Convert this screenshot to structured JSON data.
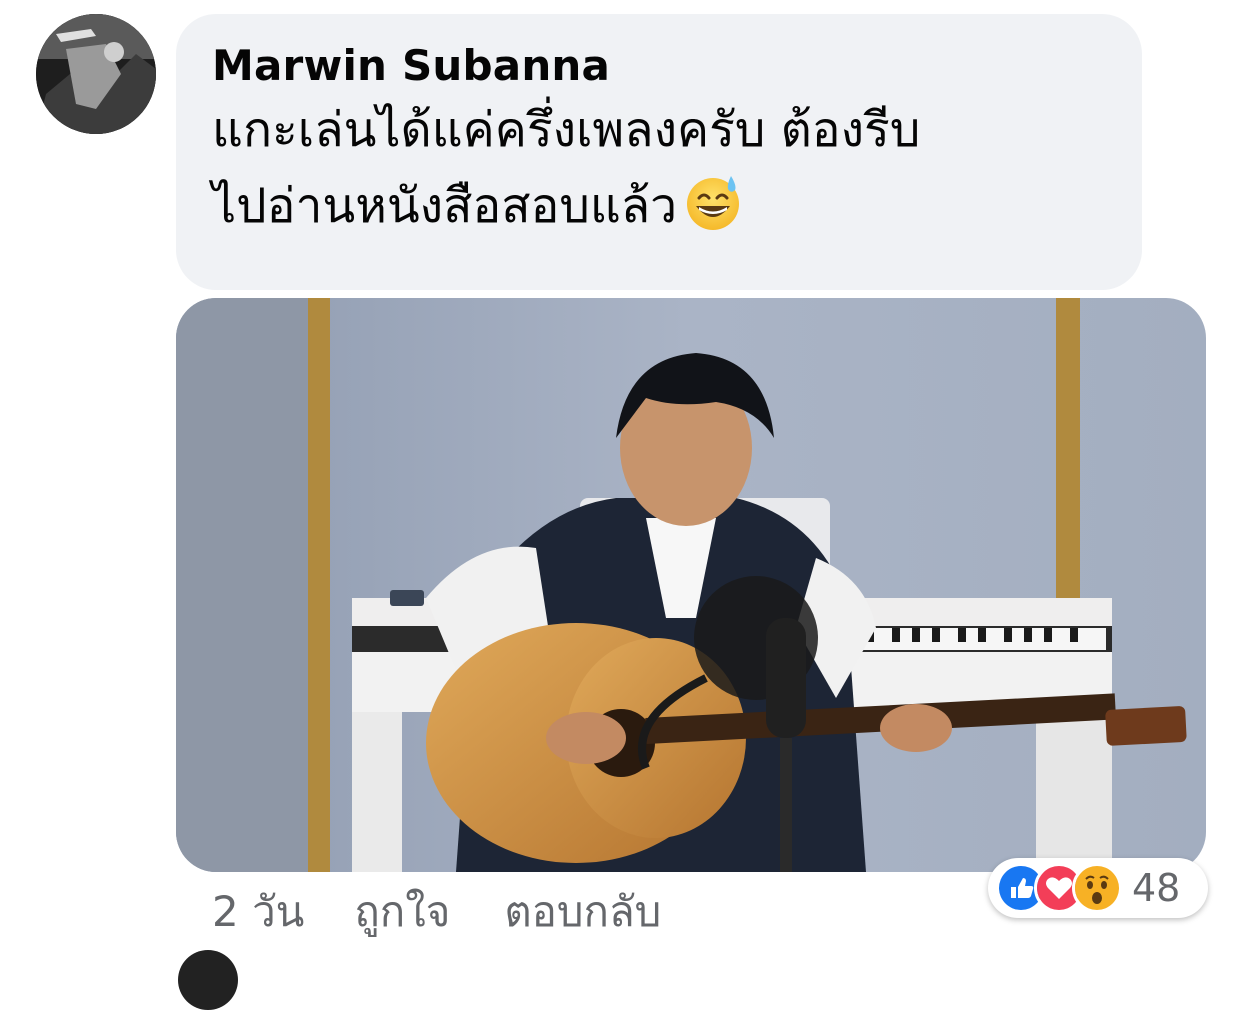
{
  "comment": {
    "author": "Marwin Subanna",
    "text_lines": [
      "แกะเล่นได้แค่ครึ่งเพลงครับ ต้องรีบ",
      "ไปอ่านหนังสือสอบแล้ว"
    ],
    "emoji": "grinning-face-with-sweat",
    "attachment": "photo-guitar-performance"
  },
  "actions": {
    "time": "2 วัน",
    "like": "ถูกใจ",
    "reply": "ตอบกลับ"
  },
  "reactions": {
    "types": [
      "like",
      "love",
      "wow"
    ],
    "count": "48",
    "colors": {
      "like": "#1877f2",
      "love": "#f33e58",
      "wow": "#f7b125"
    }
  }
}
